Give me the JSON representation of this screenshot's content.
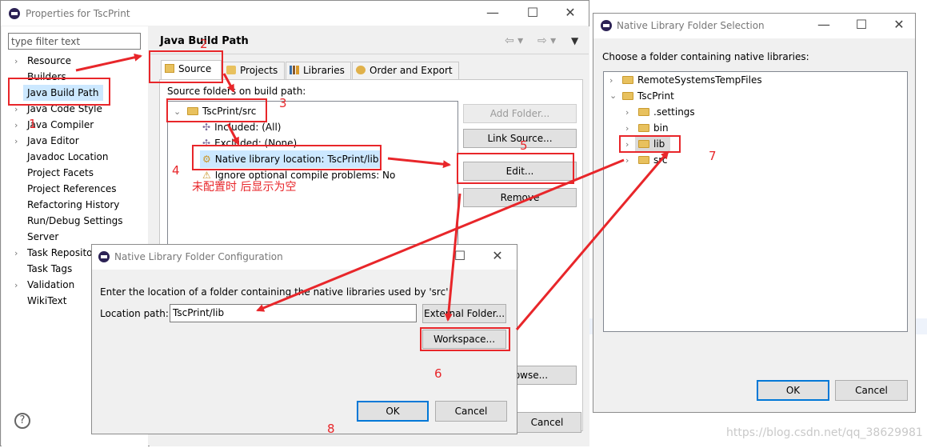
{
  "properties": {
    "title": "Properties for TscPrint",
    "filter_placeholder": "type filter text",
    "nav_items": [
      {
        "label": "Resource",
        "expandable": true
      },
      {
        "label": "Builders",
        "expandable": false
      },
      {
        "label": "Java Build Path",
        "expandable": false,
        "selected": true
      },
      {
        "label": "Java Code Style",
        "expandable": true
      },
      {
        "label": "Java Compiler",
        "expandable": true
      },
      {
        "label": "Java Editor",
        "expandable": true
      },
      {
        "label": "Javadoc Location",
        "expandable": false
      },
      {
        "label": "Project Facets",
        "expandable": false
      },
      {
        "label": "Project References",
        "expandable": false
      },
      {
        "label": "Refactoring History",
        "expandable": false
      },
      {
        "label": "Run/Debug Settings",
        "expandable": false
      },
      {
        "label": "Server",
        "expandable": false
      },
      {
        "label": "Task Repository",
        "expandable": true
      },
      {
        "label": "Task Tags",
        "expandable": false
      },
      {
        "label": "Validation",
        "expandable": true
      },
      {
        "label": "WikiText",
        "expandable": false
      }
    ],
    "page_title": "Java Build Path",
    "tabs": [
      "Source",
      "Projects",
      "Libraries",
      "Order and Export"
    ],
    "source_label": "Source folders on build path:",
    "tree": {
      "root": "TscPrint/src",
      "children": [
        "Included: (All)",
        "Excluded: (None)",
        "Native library location: TscPrint/lib",
        "Ignore optional compile problems: No"
      ]
    },
    "buttons": {
      "add_folder": "Add Folder...",
      "link_source": "Link Source...",
      "edit": "Edit...",
      "remove": "Remove",
      "browse": "Browse...",
      "cancel": "Cancel"
    },
    "help": "?"
  },
  "native_config": {
    "title": "Native Library Folder Configuration",
    "description": "Enter the location of a folder containing the native libraries used by 'src':",
    "location_label": "Location path:",
    "location_value": "TscPrint/lib",
    "external_button": "External Folder...",
    "workspace_button": "Workspace...",
    "ok": "OK",
    "cancel": "Cancel"
  },
  "folder_selection": {
    "title": "Native Library Folder Selection",
    "prompt": "Choose a folder containing native libraries:",
    "items": [
      "RemoteSystemsTempFiles",
      "TscPrint",
      ".settings",
      "bin",
      "lib",
      "src"
    ],
    "ok": "OK",
    "cancel": "Cancel"
  },
  "annotations": {
    "n1": "1",
    "n2": "2",
    "n3": "3",
    "n4": "4",
    "n5": "5",
    "n6": "6",
    "n7": "7",
    "n8": "8",
    "note": "未配置时 后显示为空",
    "watermark": "https://blog.csdn.net/qq_38629981"
  },
  "colors": {
    "annotation_red": "#e8262a",
    "selection": "#cce8ff",
    "default_button": "#0078d7"
  }
}
